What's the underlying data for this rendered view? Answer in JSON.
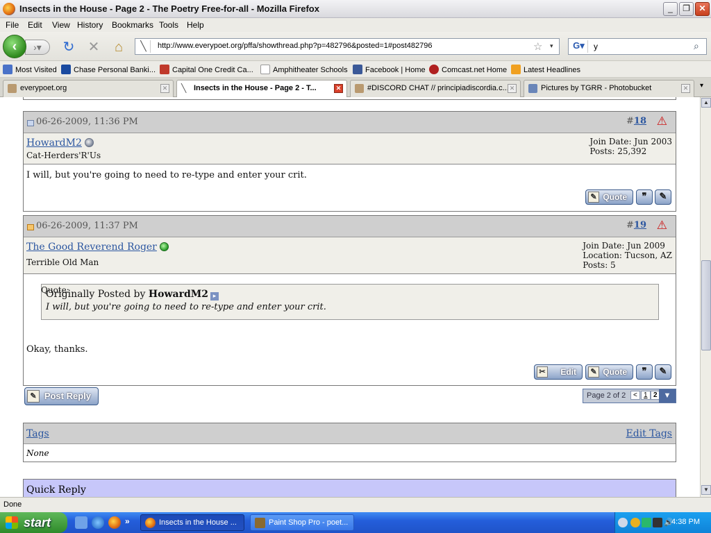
{
  "window": {
    "title": "Insects in the House - Page 2 - The Poetry Free-for-all - Mozilla Firefox"
  },
  "menu": [
    "File",
    "Edit",
    "View",
    "History",
    "Bookmarks",
    "Tools",
    "Help"
  ],
  "nav": {
    "url": "http://www.everypoet.org/pffa/showthread.php?p=482796&posted=1#post482796",
    "search_value": "y"
  },
  "bookmarks": [
    "Most Visited",
    "Chase Personal Banki...",
    "Capital One Credit Ca...",
    "Amphitheater Schools",
    "Facebook | Home",
    "Comcast.net Home",
    "Latest Headlines"
  ],
  "tabs": [
    "everypoet.org",
    "Insects in the House - Page 2 - T...",
    "#DISCORD CHAT // principiadiscordia.c...",
    "Pictures by TGRR - Photobucket"
  ],
  "posts": [
    {
      "date": "06-26-2009, 11:36 PM",
      "number_prefix": "#",
      "number": "18",
      "username": "HowardM2",
      "user_title": "Cat-Herders'R'Us",
      "stats": [
        "Join Date: Jun 2003",
        "Posts: 25,392"
      ],
      "body": "I will, but you're going to need to re-type and enter your crit.",
      "quote_button": "Quote"
    },
    {
      "date": "06-26-2009, 11:37 PM",
      "number_prefix": "#",
      "number": "19",
      "username": "The Good Reverend Roger",
      "user_title": "Terrible Old Man",
      "stats": [
        "Join Date: Jun 2009",
        "Location: Tucson, AZ",
        "Posts: 5"
      ],
      "quote_label": "Quote:",
      "quote_by_prefix": "Originally Posted by ",
      "quote_author": "HowardM2",
      "quote_text": "I will, but you're going to need to re-type and enter your crit.",
      "body": "Okay, thanks.",
      "edit_button": "Edit",
      "quote_button": "Quote"
    }
  ],
  "post_reply": "Post Reply",
  "pager": {
    "label": "Page 2 of 2",
    "prev": "<",
    "page1": "1",
    "page2": "2"
  },
  "tags": {
    "title": "Tags",
    "edit": "Edit Tags",
    "value": "None"
  },
  "quick_reply": "Quick Reply",
  "status": "Done",
  "taskbar": {
    "start": "start",
    "tasks": [
      "Insects in the House ...",
      "Paint Shop Pro - poet..."
    ],
    "time": "4:38 PM"
  }
}
